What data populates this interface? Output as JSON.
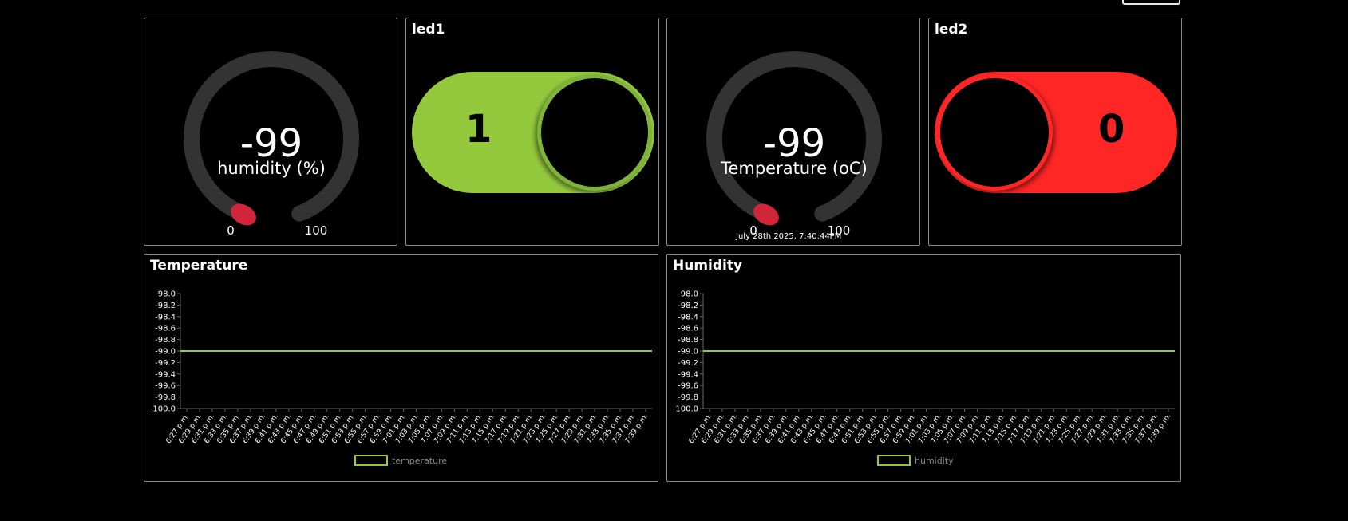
{
  "humidity_gauge": {
    "value": "-99",
    "label": "humidity (%)",
    "min": "0",
    "max": "100",
    "fill": 0
  },
  "led1": {
    "title": "led1",
    "value": "1",
    "color": "#94c93d"
  },
  "temperature_gauge": {
    "value": "-99",
    "label": "Temperature (oC)",
    "min": "0",
    "max": "100",
    "fill": 0,
    "timestamp": "July 28th 2025, 7:40:44PM"
  },
  "led2": {
    "title": "led2",
    "value": "0",
    "color": "#ff2626"
  },
  "chart_data": [
    {
      "type": "line",
      "title": "Temperature",
      "ylim": [
        -100.0,
        -98.0
      ],
      "yticks": [
        "-98.0",
        "-98.2",
        "-98.4",
        "-98.6",
        "-98.8",
        "-99.0",
        "-99.2",
        "-99.4",
        "-99.6",
        "-99.8",
        "-100.0"
      ],
      "x": [
        "6:27 p.m.",
        "6:29 p.m.",
        "6:31 p.m.",
        "6:33 p.m.",
        "6:35 p.m.",
        "6:37 p.m.",
        "6:39 p.m.",
        "6:41 p.m.",
        "6:43 p.m.",
        "6:45 p.m.",
        "6:47 p.m.",
        "6:49 p.m.",
        "6:51 p.m.",
        "6:53 p.m.",
        "6:55 p.m.",
        "6:57 p.m.",
        "6:59 p.m.",
        "7:01 p.m.",
        "7:03 p.m.",
        "7:05 p.m.",
        "7:07 p.m.",
        "7:09 p.m.",
        "7:11 p.m.",
        "7:13 p.m.",
        "7:15 p.m.",
        "7:17 p.m.",
        "7:19 p.m.",
        "7:21 p.m.",
        "7:23 p.m.",
        "7:25 p.m.",
        "7:27 p.m.",
        "7:29 p.m.",
        "7:31 p.m.",
        "7:33 p.m.",
        "7:35 p.m.",
        "7:37 p.m.",
        "7:39 p.m."
      ],
      "series": [
        {
          "name": "temperature",
          "value": -99.0,
          "color": "#94c93d"
        }
      ],
      "grid": false,
      "legend": "bottom"
    },
    {
      "type": "line",
      "title": "Humidity",
      "ylim": [
        -100.0,
        -98.0
      ],
      "yticks": [
        "-98.0",
        "-98.2",
        "-98.4",
        "-98.6",
        "-98.8",
        "-99.0",
        "-99.2",
        "-99.4",
        "-99.6",
        "-99.8",
        "-100.0"
      ],
      "x": [
        "6:27 p.m.",
        "6:29 p.m.",
        "6:31 p.m.",
        "6:33 p.m.",
        "6:35 p.m.",
        "6:37 p.m.",
        "6:39 p.m.",
        "6:41 p.m.",
        "6:43 p.m.",
        "6:45 p.m.",
        "6:47 p.m.",
        "6:49 p.m.",
        "6:51 p.m.",
        "6:53 p.m.",
        "6:55 p.m.",
        "6:57 p.m.",
        "6:59 p.m.",
        "7:01 p.m.",
        "7:03 p.m.",
        "7:05 p.m.",
        "7:07 p.m.",
        "7:09 p.m.",
        "7:11 p.m.",
        "7:13 p.m.",
        "7:15 p.m.",
        "7:17 p.m.",
        "7:19 p.m.",
        "7:21 p.m.",
        "7:23 p.m.",
        "7:25 p.m.",
        "7:27 p.m.",
        "7:29 p.m.",
        "7:31 p.m.",
        "7:33 p.m.",
        "7:35 p.m.",
        "7:37 p.m.",
        "7:39 p.m."
      ],
      "series": [
        {
          "name": "humidity",
          "value": -99.0,
          "color": "#94c93d"
        }
      ],
      "grid": false,
      "legend": "bottom"
    }
  ],
  "colors": {
    "gauge_track": "#333333",
    "gauge_marker": "#d0263a",
    "border": "#8a8a8a",
    "axis_text": "#ffffff",
    "legend_text": "#888888"
  }
}
